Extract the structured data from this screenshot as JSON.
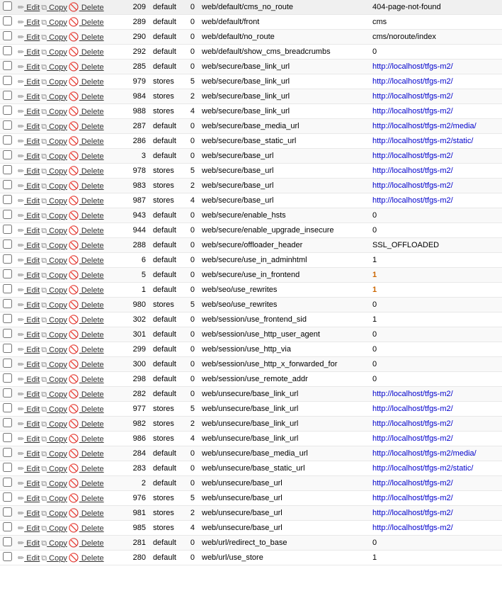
{
  "table": {
    "rows": [
      {
        "id": 209,
        "scope": "default",
        "scope_id": 0,
        "path": "web/default/cms_no_route",
        "value": "404-page-not-found",
        "is_link": false
      },
      {
        "id": 289,
        "scope": "default",
        "scope_id": 0,
        "path": "web/default/front",
        "value": "cms",
        "is_link": false
      },
      {
        "id": 290,
        "scope": "default",
        "scope_id": 0,
        "path": "web/default/no_route",
        "value": "cms/noroute/index",
        "is_link": false
      },
      {
        "id": 292,
        "scope": "default",
        "scope_id": 0,
        "path": "web/default/show_cms_breadcrumbs",
        "value": "0",
        "is_link": false
      },
      {
        "id": 285,
        "scope": "default",
        "scope_id": 0,
        "path": "web/secure/base_link_url",
        "value": "http://localhost/tfgs-m2/",
        "is_link": true
      },
      {
        "id": 979,
        "scope": "stores",
        "scope_id": 5,
        "path": "web/secure/base_link_url",
        "value": "http://localhost/tfgs-m2/",
        "is_link": true
      },
      {
        "id": 984,
        "scope": "stores",
        "scope_id": 2,
        "path": "web/secure/base_link_url",
        "value": "http://localhost/tfgs-m2/",
        "is_link": true
      },
      {
        "id": 988,
        "scope": "stores",
        "scope_id": 4,
        "path": "web/secure/base_link_url",
        "value": "http://localhost/tfgs-m2/",
        "is_link": true
      },
      {
        "id": 287,
        "scope": "default",
        "scope_id": 0,
        "path": "web/secure/base_media_url",
        "value": "http://localhost/tfgs-m2/media/",
        "is_link": true
      },
      {
        "id": 286,
        "scope": "default",
        "scope_id": 0,
        "path": "web/secure/base_static_url",
        "value": "http://localhost/tfgs-m2/static/",
        "is_link": true
      },
      {
        "id": 3,
        "scope": "default",
        "scope_id": 0,
        "path": "web/secure/base_url",
        "value": "http://localhost/tfgs-m2/",
        "is_link": true
      },
      {
        "id": 978,
        "scope": "stores",
        "scope_id": 5,
        "path": "web/secure/base_url",
        "value": "http://localhost/tfgs-m2/",
        "is_link": true
      },
      {
        "id": 983,
        "scope": "stores",
        "scope_id": 2,
        "path": "web/secure/base_url",
        "value": "http://localhost/tfgs-m2/",
        "is_link": true
      },
      {
        "id": 987,
        "scope": "stores",
        "scope_id": 4,
        "path": "web/secure/base_url",
        "value": "http://localhost/tfgs-m2/",
        "is_link": true
      },
      {
        "id": 943,
        "scope": "default",
        "scope_id": 0,
        "path": "web/secure/enable_hsts",
        "value": "0",
        "is_link": false
      },
      {
        "id": 944,
        "scope": "default",
        "scope_id": 0,
        "path": "web/secure/enable_upgrade_insecure",
        "value": "0",
        "is_link": false
      },
      {
        "id": 288,
        "scope": "default",
        "scope_id": 0,
        "path": "web/secure/offloader_header",
        "value": "SSL_OFFLOADED",
        "is_link": false
      },
      {
        "id": 6,
        "scope": "default",
        "scope_id": 0,
        "path": "web/secure/use_in_adminhtml",
        "value": "1",
        "is_link": false
      },
      {
        "id": 5,
        "scope": "default",
        "scope_id": 0,
        "path": "web/secure/use_in_frontend",
        "value": "1",
        "is_link": false,
        "bold": true
      },
      {
        "id": 1,
        "scope": "default",
        "scope_id": 0,
        "path": "web/seo/use_rewrites",
        "value": "1",
        "is_link": false,
        "bold": true
      },
      {
        "id": 980,
        "scope": "stores",
        "scope_id": 5,
        "path": "web/seo/use_rewrites",
        "value": "0",
        "is_link": false
      },
      {
        "id": 302,
        "scope": "default",
        "scope_id": 0,
        "path": "web/session/use_frontend_sid",
        "value": "1",
        "is_link": false
      },
      {
        "id": 301,
        "scope": "default",
        "scope_id": 0,
        "path": "web/session/use_http_user_agent",
        "value": "0",
        "is_link": false
      },
      {
        "id": 299,
        "scope": "default",
        "scope_id": 0,
        "path": "web/session/use_http_via",
        "value": "0",
        "is_link": false
      },
      {
        "id": 300,
        "scope": "default",
        "scope_id": 0,
        "path": "web/session/use_http_x_forwarded_for",
        "value": "0",
        "is_link": false
      },
      {
        "id": 298,
        "scope": "default",
        "scope_id": 0,
        "path": "web/session/use_remote_addr",
        "value": "0",
        "is_link": false
      },
      {
        "id": 282,
        "scope": "default",
        "scope_id": 0,
        "path": "web/unsecure/base_link_url",
        "value": "http://localhost/tfgs-m2/",
        "is_link": true
      },
      {
        "id": 977,
        "scope": "stores",
        "scope_id": 5,
        "path": "web/unsecure/base_link_url",
        "value": "http://localhost/tfgs-m2/",
        "is_link": true
      },
      {
        "id": 982,
        "scope": "stores",
        "scope_id": 2,
        "path": "web/unsecure/base_link_url",
        "value": "http://localhost/tfgs-m2/",
        "is_link": true
      },
      {
        "id": 986,
        "scope": "stores",
        "scope_id": 4,
        "path": "web/unsecure/base_link_url",
        "value": "http://localhost/tfgs-m2/",
        "is_link": true
      },
      {
        "id": 284,
        "scope": "default",
        "scope_id": 0,
        "path": "web/unsecure/base_media_url",
        "value": "http://localhost/tfgs-m2/media/",
        "is_link": true
      },
      {
        "id": 283,
        "scope": "default",
        "scope_id": 0,
        "path": "web/unsecure/base_static_url",
        "value": "http://localhost/tfgs-m2/static/",
        "is_link": true
      },
      {
        "id": 2,
        "scope": "default",
        "scope_id": 0,
        "path": "web/unsecure/base_url",
        "value": "http://localhost/tfgs-m2/",
        "is_link": true
      },
      {
        "id": 976,
        "scope": "stores",
        "scope_id": 5,
        "path": "web/unsecure/base_url",
        "value": "http://localhost/tfgs-m2/",
        "is_link": true
      },
      {
        "id": 981,
        "scope": "stores",
        "scope_id": 2,
        "path": "web/unsecure/base_url",
        "value": "http://localhost/tfgs-m2/",
        "is_link": true
      },
      {
        "id": 985,
        "scope": "stores",
        "scope_id": 4,
        "path": "web/unsecure/base_url",
        "value": "http://localhost/tfgs-m2/",
        "is_link": true
      },
      {
        "id": 281,
        "scope": "default",
        "scope_id": 0,
        "path": "web/url/redirect_to_base",
        "value": "0",
        "is_link": false
      },
      {
        "id": 280,
        "scope": "default",
        "scope_id": 0,
        "path": "web/url/use_store",
        "value": "1",
        "is_link": false
      }
    ],
    "buttons": {
      "edit": "Edit",
      "copy": "Copy",
      "delete": "Delete"
    }
  }
}
